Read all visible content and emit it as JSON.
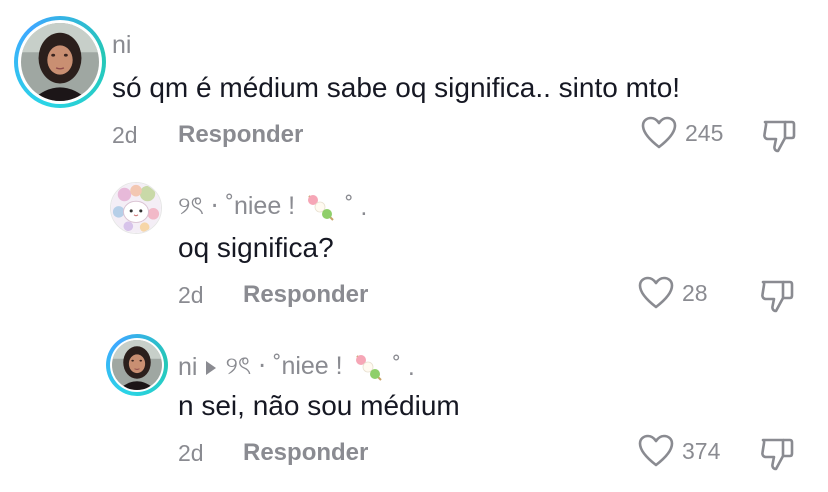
{
  "comments": [
    {
      "username": "ni",
      "text": "só qm é médium sabe oq significa.. sinto mto!",
      "time": "2d",
      "reply_label": "Responder",
      "likes": "245"
    },
    {
      "username": "୨ৎ ⋅ ˚niee !",
      "username_suffix": "˚ .",
      "text": "oq significa?",
      "time": "2d",
      "reply_label": "Responder",
      "likes": "28"
    },
    {
      "username": "ni",
      "reply_to": "୨ৎ ⋅ ˚niee !",
      "reply_to_suffix": "˚ .",
      "text": "n sei, não sou médium",
      "time": "2d",
      "reply_label": "Responder",
      "likes": "374"
    }
  ],
  "icons": {
    "like": "heart-outline-icon",
    "dislike": "thumbs-down-outline-icon",
    "reply_arrow": "play-triangle-icon"
  },
  "colors": {
    "avatar_ring": "#2ad4e6",
    "muted_text": "#8a8b91",
    "main_text": "#161823"
  }
}
